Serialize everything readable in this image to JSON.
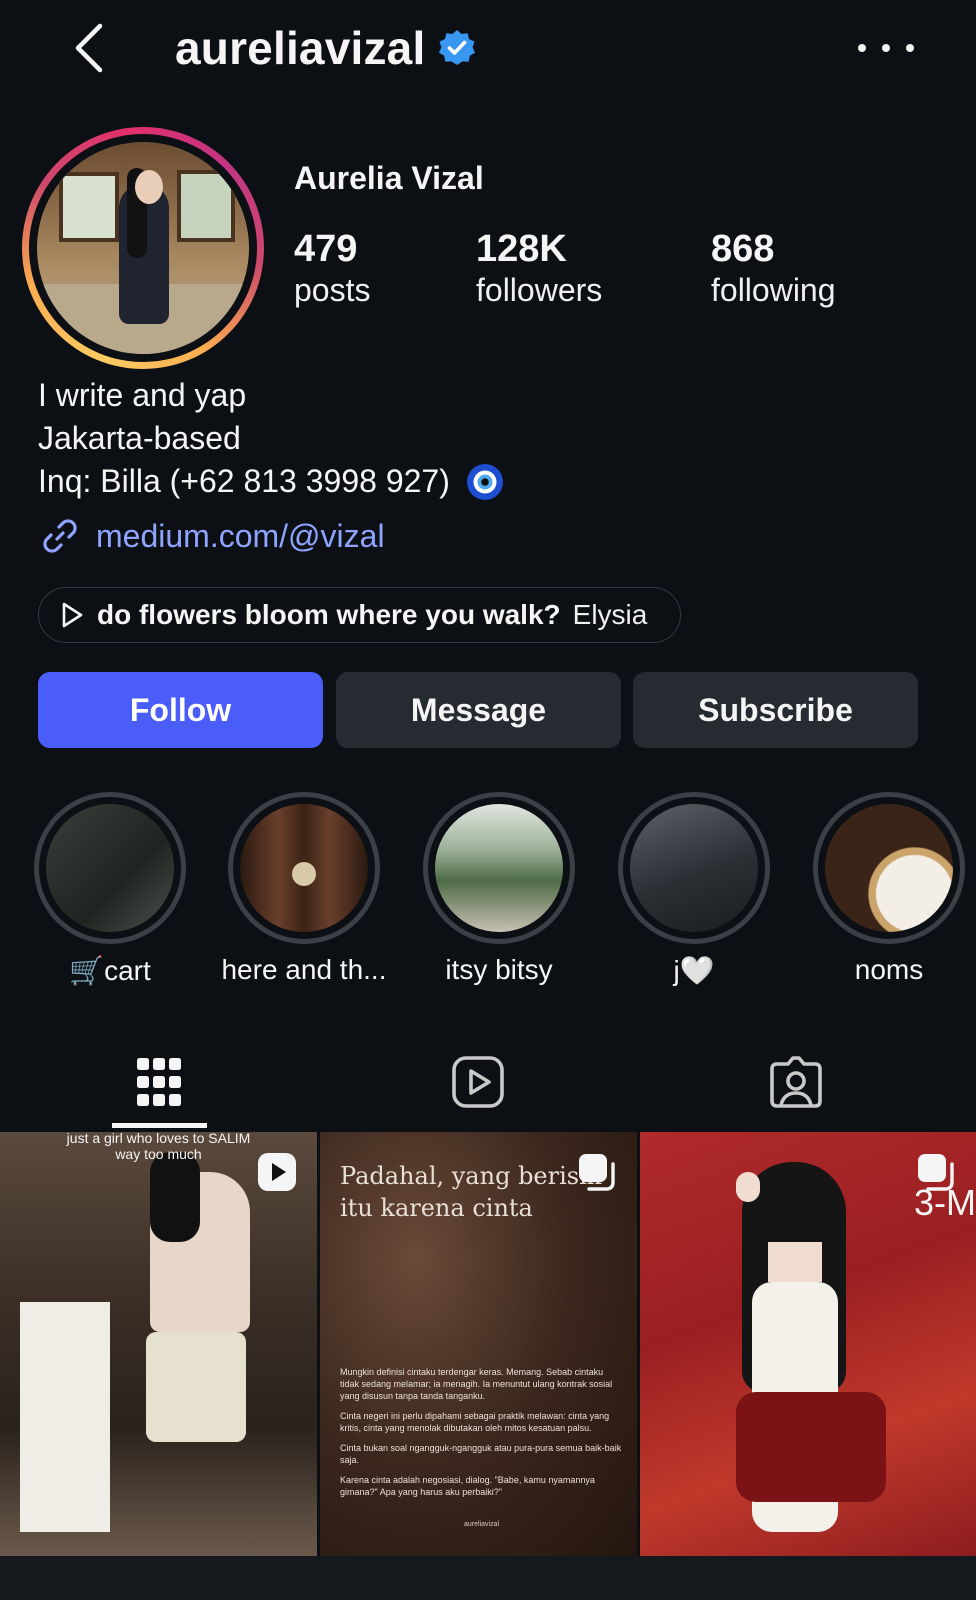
{
  "header": {
    "username": "aureliavizal",
    "verified_icon": "verified-badge-icon",
    "back_icon": "chevron-left-icon",
    "more_icon": "more-horizontal-icon"
  },
  "profile": {
    "display_name": "Aurelia Vizal",
    "stats": [
      {
        "value": "479",
        "label": "posts"
      },
      {
        "value": "128K",
        "label": "followers"
      },
      {
        "value": "868",
        "label": "following"
      }
    ]
  },
  "bio": {
    "line1": "I write and yap",
    "line2": "Jakarta-based",
    "line3": "Inq: Billa (+62 813 3998 927)",
    "emoji_icon": "nazar-amulet-icon",
    "link": "medium.com/@vizal"
  },
  "music": {
    "title": "do flowers bloom where you walk?",
    "artist": "Elysia"
  },
  "actions": {
    "follow": "Follow",
    "message": "Message",
    "subscribe": "Subscribe",
    "follow_color": "#4a5df9"
  },
  "highlights": [
    {
      "label": "🛒cart"
    },
    {
      "label": "here and th..."
    },
    {
      "label": "itsy bitsy"
    },
    {
      "label": "j🤍"
    },
    {
      "label": "noms"
    }
  ],
  "tabs": [
    {
      "icon": "grid-icon",
      "active": true
    },
    {
      "icon": "reels-icon",
      "active": false
    },
    {
      "icon": "tagged-icon",
      "active": false
    }
  ],
  "posts": {
    "post1_caption": "just a girl who loves to SALIM\nway too much",
    "post2_title": "Padahal, yang berisik itu karena cinta",
    "post2_body": [
      "Mungkin definisi cintaku terdengar keras. Memang. Sebab cintaku tidak sedang melamar; ia menagih. Ia menuntut ulang kontrak sosial yang disusun tanpa tanda tanganku.",
      "Cinta negeri ini perlu dipahami sebagai praktik melawan: cinta yang kritis, cinta yang menolak dibutakan oleh mitos kesatuan palsu.",
      "Cinta bukan soal ngangguk-ngangguk atau pura-pura semua baik-baik saja.",
      "Karena cinta adalah negosiasi, dialog. \"Babe, kamu nyamannya gimana?\" Apa yang harus aku perbaiki?\""
    ],
    "post2_credit": "aureliavizal",
    "post3_tag": "3-M"
  }
}
